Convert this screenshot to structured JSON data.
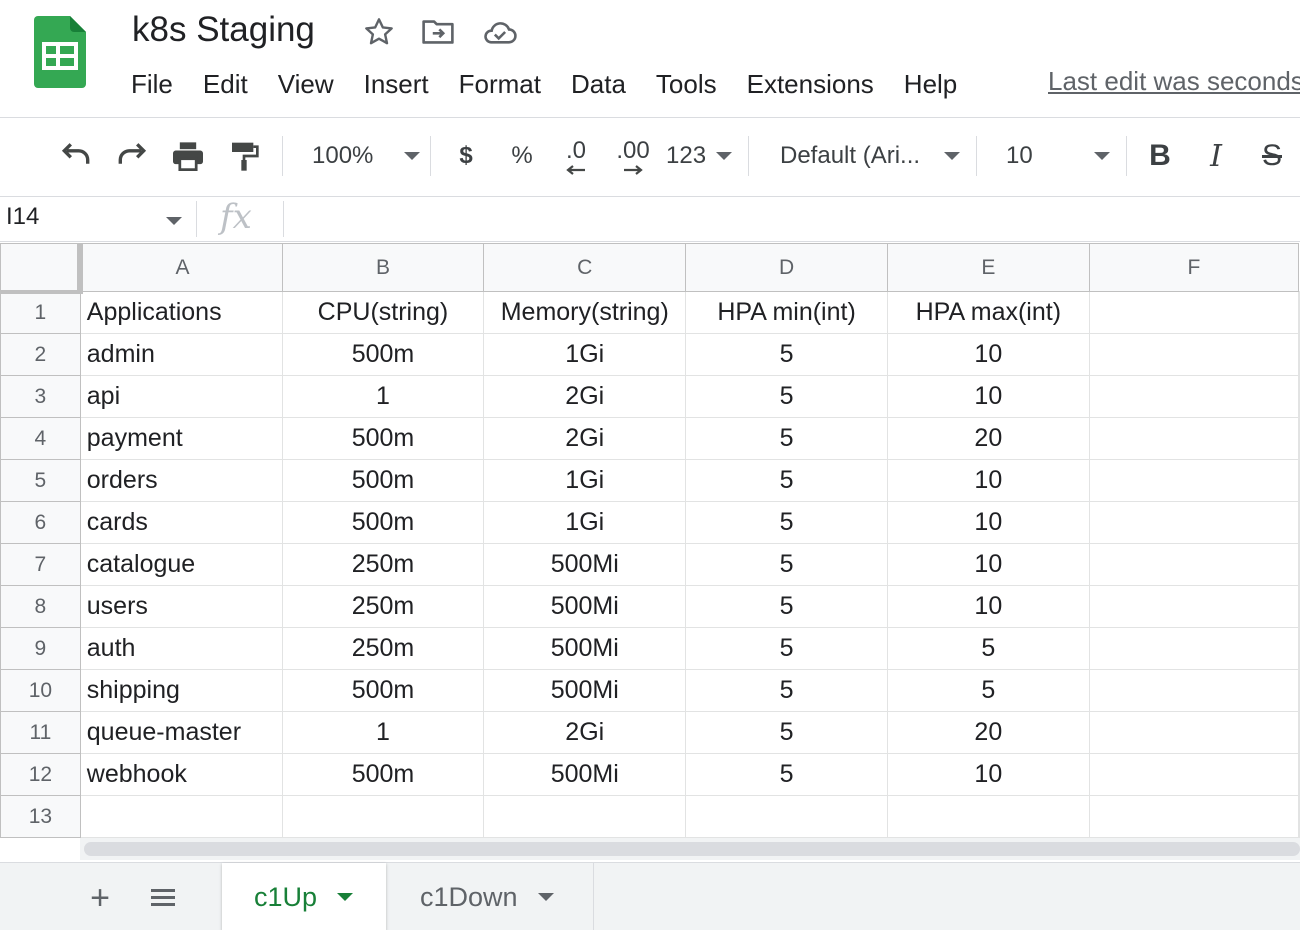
{
  "app": {
    "document_title": "k8s Staging",
    "last_edit": "Last edit was seconds ago"
  },
  "menu": [
    "File",
    "Edit",
    "View",
    "Insert",
    "Format",
    "Data",
    "Tools",
    "Extensions",
    "Help"
  ],
  "toolbar": {
    "zoom": "100%",
    "currency": "$",
    "percent": "%",
    "decrease_decimal": ".0",
    "increase_decimal": ".00",
    "number_format": "123",
    "font": "Default (Ari...",
    "font_size": "10",
    "bold": "B",
    "italic": "I",
    "strike": "S"
  },
  "formula_bar": {
    "name_box": "I14",
    "fx": "fx",
    "value": ""
  },
  "grid": {
    "columns": [
      "A",
      "B",
      "C",
      "D",
      "E",
      "F"
    ],
    "rows": [
      {
        "n": "1",
        "cells": [
          "Applications",
          "CPU(string)",
          "Memory(string)",
          "HPA min(int)",
          "HPA max(int)",
          ""
        ]
      },
      {
        "n": "2",
        "cells": [
          "admin",
          "500m",
          "1Gi",
          "5",
          "10",
          ""
        ]
      },
      {
        "n": "3",
        "cells": [
          "api",
          "1",
          "2Gi",
          "5",
          "10",
          ""
        ]
      },
      {
        "n": "4",
        "cells": [
          "payment",
          "500m",
          "2Gi",
          "5",
          "20",
          ""
        ]
      },
      {
        "n": "5",
        "cells": [
          "orders",
          "500m",
          "1Gi",
          "5",
          "10",
          ""
        ]
      },
      {
        "n": "6",
        "cells": [
          "cards",
          "500m",
          "1Gi",
          "5",
          "10",
          ""
        ]
      },
      {
        "n": "7",
        "cells": [
          "catalogue",
          "250m",
          "500Mi",
          "5",
          "10",
          ""
        ]
      },
      {
        "n": "8",
        "cells": [
          "users",
          "250m",
          "500Mi",
          "5",
          "10",
          ""
        ]
      },
      {
        "n": "9",
        "cells": [
          "auth",
          "250m",
          "500Mi",
          "5",
          "5",
          ""
        ]
      },
      {
        "n": "10",
        "cells": [
          "shipping",
          "500m",
          "500Mi",
          "5",
          "5",
          ""
        ]
      },
      {
        "n": "11",
        "cells": [
          "queue-master",
          "1",
          "2Gi",
          "5",
          "20",
          ""
        ]
      },
      {
        "n": "12",
        "cells": [
          "webhook",
          "500m",
          "500Mi",
          "5",
          "10",
          ""
        ]
      },
      {
        "n": "13",
        "cells": [
          "",
          "",
          "",
          "",
          "",
          ""
        ]
      }
    ]
  },
  "sheets": {
    "add": "+",
    "tabs": [
      {
        "label": "c1Up",
        "active": true
      },
      {
        "label": "c1Down",
        "active": false
      }
    ]
  },
  "colors": {
    "sheets_green": "#188038",
    "logo_green": "#34a853",
    "header_bg": "#f8f9fa",
    "gridline": "#e2e3e3"
  }
}
